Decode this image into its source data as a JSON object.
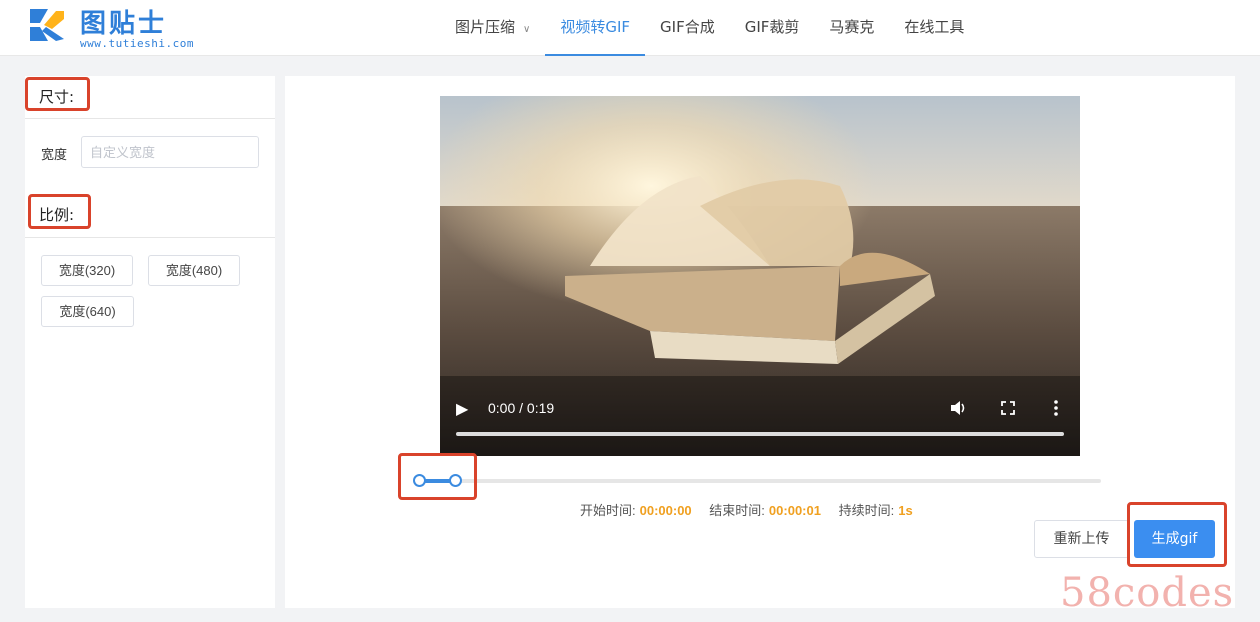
{
  "header": {
    "logo_name": "图贴士",
    "logo_url": "www.tutieshi.com",
    "brand_color": "#2f7fd8",
    "nav": [
      {
        "label": "图片压缩",
        "has_dropdown": true
      },
      {
        "label": "视频转GIF",
        "active": true
      },
      {
        "label": "GIF合成"
      },
      {
        "label": "GIF裁剪"
      },
      {
        "label": "马赛克"
      },
      {
        "label": "在线工具"
      }
    ]
  },
  "sidebar": {
    "size_title": "尺寸:",
    "width_label": "宽度",
    "width_placeholder": "自定义宽度",
    "ratio_title": "比例:",
    "ratio_buttons": [
      "宽度(320)",
      "宽度(480)",
      "宽度(640)"
    ]
  },
  "video": {
    "time_display": "0:00 / 0:19",
    "icons": [
      "play-icon",
      "volume-icon",
      "fullscreen-icon",
      "more-options-icon"
    ]
  },
  "trim": {
    "start_label": "开始时间:",
    "start_value": "00:00:00",
    "end_label": "结束时间:",
    "end_value": "00:00:01",
    "duration_label": "持续时间:",
    "duration_value": "1s"
  },
  "actions": {
    "reupload_label": "重新上传",
    "generate_label": "生成gif"
  },
  "accent_color": "#3b8be0",
  "highlight_color": "#d9432b",
  "watermark": "58codes"
}
